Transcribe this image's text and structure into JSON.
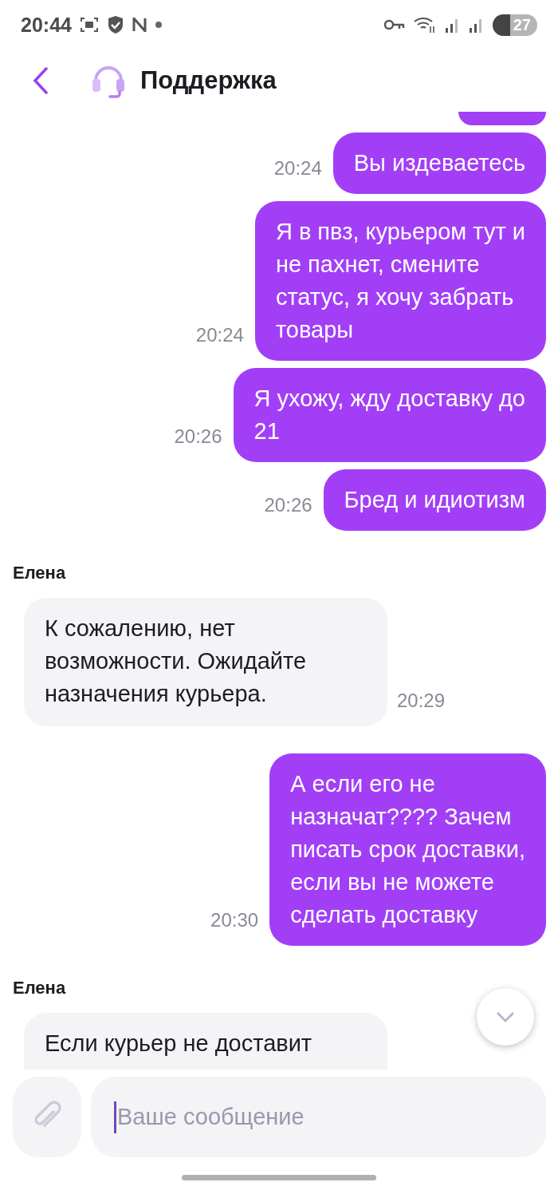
{
  "status_bar": {
    "time": "20:44",
    "battery": "27"
  },
  "header": {
    "title": "Поддержка"
  },
  "messages": [
    {
      "kind": "partial",
      "outgoing": true
    },
    {
      "kind": "text",
      "outgoing": true,
      "lines": [
        "Вы издеваетесь"
      ],
      "time": "20:24"
    },
    {
      "kind": "text",
      "outgoing": true,
      "lines": [
        "Я в пвз, курьером тут и",
        "не пахнет, смените",
        "статус, я хочу забрать",
        "товары"
      ],
      "time": "20:24"
    },
    {
      "kind": "text",
      "outgoing": true,
      "lines": [
        "Я ухожу, жду доставку до",
        "21"
      ],
      "time": "20:26"
    },
    {
      "kind": "text",
      "outgoing": true,
      "lines": [
        "Бред и идиотизм"
      ],
      "time": "20:26"
    },
    {
      "kind": "text",
      "outgoing": false,
      "sender": "Елена",
      "lines": [
        "К сожалению, нет",
        "возможности. Ожидайте",
        "назначения курьера."
      ],
      "time": "20:29"
    },
    {
      "kind": "text",
      "outgoing": true,
      "lines": [
        "А если его не",
        "назначат???? Зачем",
        "писать срок доставки,",
        "если вы не можете",
        "сделать доставку"
      ],
      "time": "20:30"
    },
    {
      "kind": "cut",
      "outgoing": false,
      "sender": "Елена",
      "lines": [
        "Если курьер не доставит"
      ]
    }
  ],
  "composer": {
    "placeholder": "Ваше сообщение"
  }
}
